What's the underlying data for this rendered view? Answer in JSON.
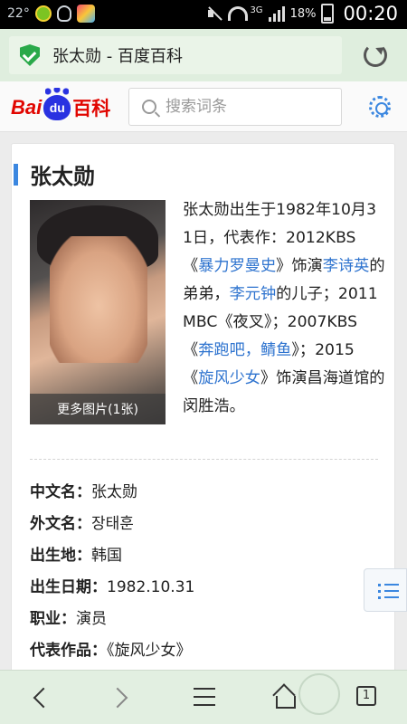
{
  "status_bar": {
    "temperature": "22°",
    "network": "3G",
    "battery": "18%",
    "time": "00:20"
  },
  "url_bar": {
    "page_title": "张太勋 - 百度百科"
  },
  "header": {
    "logo": {
      "bai": "Bai",
      "du": "du",
      "baike": "百科"
    },
    "search_placeholder": "搜索词条"
  },
  "entry": {
    "title": "张太勋",
    "photo_caption": "更多图片(1张)",
    "intro": [
      {
        "text": "张太勋出生于1982年10月31日，代表作：2012KBS《"
      },
      {
        "link": "暴力罗曼史"
      },
      {
        "text": "》饰演"
      },
      {
        "link": "李诗英"
      },
      {
        "text": "的弟弟，"
      },
      {
        "link": "李元钟"
      },
      {
        "text": "的儿子；2011MBC《夜叉》；2007KBS《"
      },
      {
        "link": "奔跑吧，鲭鱼"
      },
      {
        "text": "》；2015《"
      },
      {
        "link": "旋风少女"
      },
      {
        "text": "》饰演昌海道馆的闵胜浩。"
      }
    ],
    "infobox": [
      {
        "key": "中文名",
        "sep": "：",
        "value": "张太勋"
      },
      {
        "key": "外文名",
        "sep": "：",
        "value": "장태훈"
      },
      {
        "key": "出生地",
        "sep": "：",
        "value": "韩国"
      },
      {
        "key": "出生日期",
        "sep": "：",
        "value": "1982.10.31"
      },
      {
        "key": "职业",
        "sep": "：",
        "value": "演员"
      },
      {
        "key": "代表作品",
        "sep": "：",
        "value": "《旋风少女》"
      }
    ]
  },
  "bottom_nav": {
    "tab_count": "1"
  },
  "colors": {
    "accent_blue": "#3b87e0",
    "link": "#2f74cf",
    "baidu_red": "#e10601",
    "baidu_blue": "#2932e1",
    "bar_green": "#dfeede"
  }
}
